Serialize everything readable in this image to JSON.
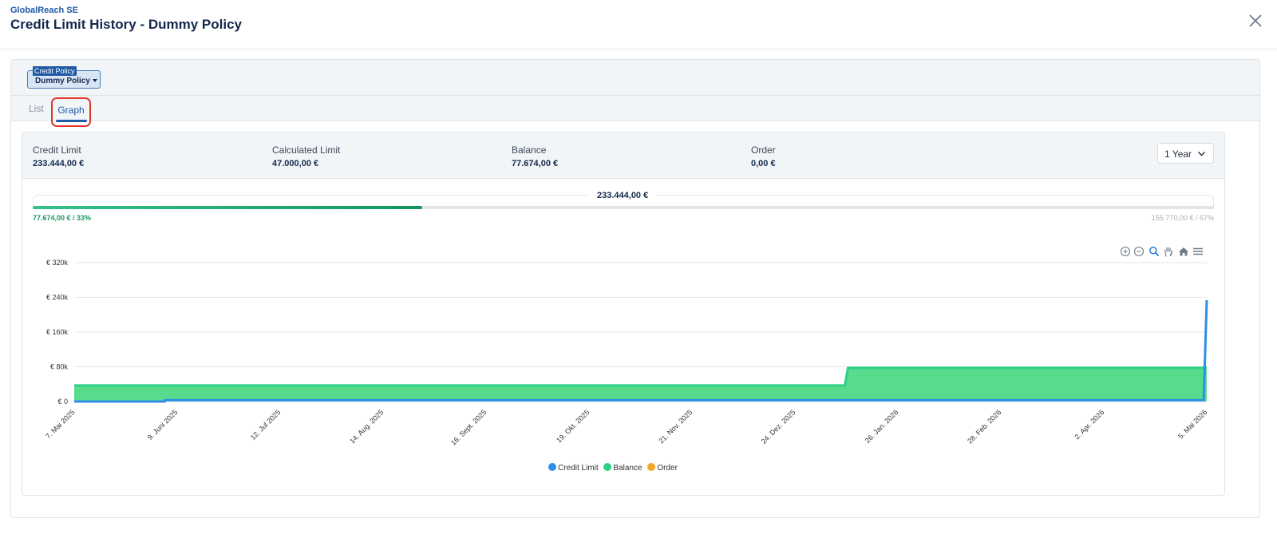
{
  "header": {
    "company": "GlobalReach SE",
    "title": "Credit Limit History - Dummy Policy"
  },
  "policy_select": {
    "tag": "Credit Policy",
    "value": "Dummy Policy"
  },
  "tabs": [
    {
      "label": "List",
      "active": false
    },
    {
      "label": "Graph",
      "active": true
    }
  ],
  "stats": [
    {
      "label": "Credit Limit",
      "value": "233.444,00 €"
    },
    {
      "label": "Calculated Limit",
      "value": "47.000,00 €"
    },
    {
      "label": "Balance",
      "value": "77.674,00 €"
    },
    {
      "label": "Order",
      "value": "0,00 €"
    }
  ],
  "period_select": {
    "value": "1 Year"
  },
  "usage_bar": {
    "total": "233.444,00 €",
    "used_label": "77.674,00 € / 33%",
    "remaining_label": "155.770,00 € / 67%",
    "used_fraction": 0.33
  },
  "toolbar_icons": [
    "zoom-in-icon",
    "zoom-out-icon",
    "zoom-select-icon",
    "pan-hand-icon",
    "home-reset-icon",
    "menu-icon"
  ],
  "colors": {
    "credit_limit": "#2f8fe5",
    "balance": "#2ecf86",
    "balance_fill": "#57dc8d",
    "order": "#f5a623",
    "accent": "#1f5aa6"
  },
  "chart_data": {
    "type": "area",
    "x_tick_labels": [
      "7. Mai 2025",
      "9. Juni 2025",
      "12. Jul 2025",
      "14. Aug. 2025",
      "16. Sept. 2025",
      "19. Okt. 2025",
      "21. Nov. 2025",
      "24. Dez. 2025",
      "26. Jan. 2026",
      "28. Feb. 2026",
      "2. Apr. 2026",
      "5. Mai 2026"
    ],
    "y_tick_labels": [
      "€ 0",
      "€ 80k",
      "€ 160k",
      "€ 240k",
      "€ 320k"
    ],
    "ylim": [
      0,
      320000
    ],
    "xlim": [
      "2025-05-07",
      "2026-05-05"
    ],
    "grid": true,
    "legend_position": "bottom",
    "series": [
      {
        "name": "Credit Limit",
        "color": "#2f8fe5",
        "points": [
          {
            "x": "2025-05-07",
            "y": 0
          },
          {
            "x": "2025-06-05",
            "y": 0
          },
          {
            "x": "2025-06-05",
            "y": 3000
          },
          {
            "x": "2026-05-04",
            "y": 3000
          },
          {
            "x": "2026-05-05",
            "y": 233444
          }
        ]
      },
      {
        "name": "Balance",
        "color": "#2ecf86",
        "points": [
          {
            "x": "2025-05-07",
            "y": 37000
          },
          {
            "x": "2026-01-09",
            "y": 37000
          },
          {
            "x": "2026-01-10",
            "y": 77674
          },
          {
            "x": "2026-05-05",
            "y": 77674
          }
        ]
      },
      {
        "name": "Order",
        "color": "#f5a623",
        "points": []
      }
    ]
  }
}
